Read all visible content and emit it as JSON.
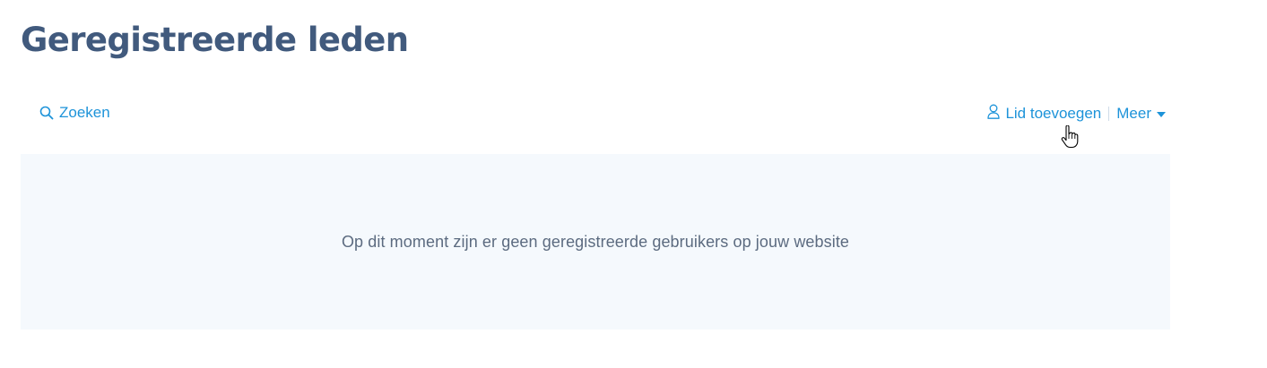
{
  "page": {
    "title": "Geregistreerde leden"
  },
  "toolbar": {
    "search_label": "Zoeken",
    "add_member_label": "Lid toevoegen",
    "more_label": "Meer"
  },
  "empty_state": {
    "message": "Op dit moment zijn er geen geregistreerde gebruikers op jouw website"
  },
  "icons": {
    "search": "search-icon",
    "add_member": "user-icon",
    "more": "caret-down-icon",
    "cursor": "hand-pointer-cursor-icon"
  },
  "colors": {
    "title": "#415a7d",
    "link": "#1d93d9",
    "panel_background": "#f5f9fd",
    "message_text": "#5c6b80"
  }
}
